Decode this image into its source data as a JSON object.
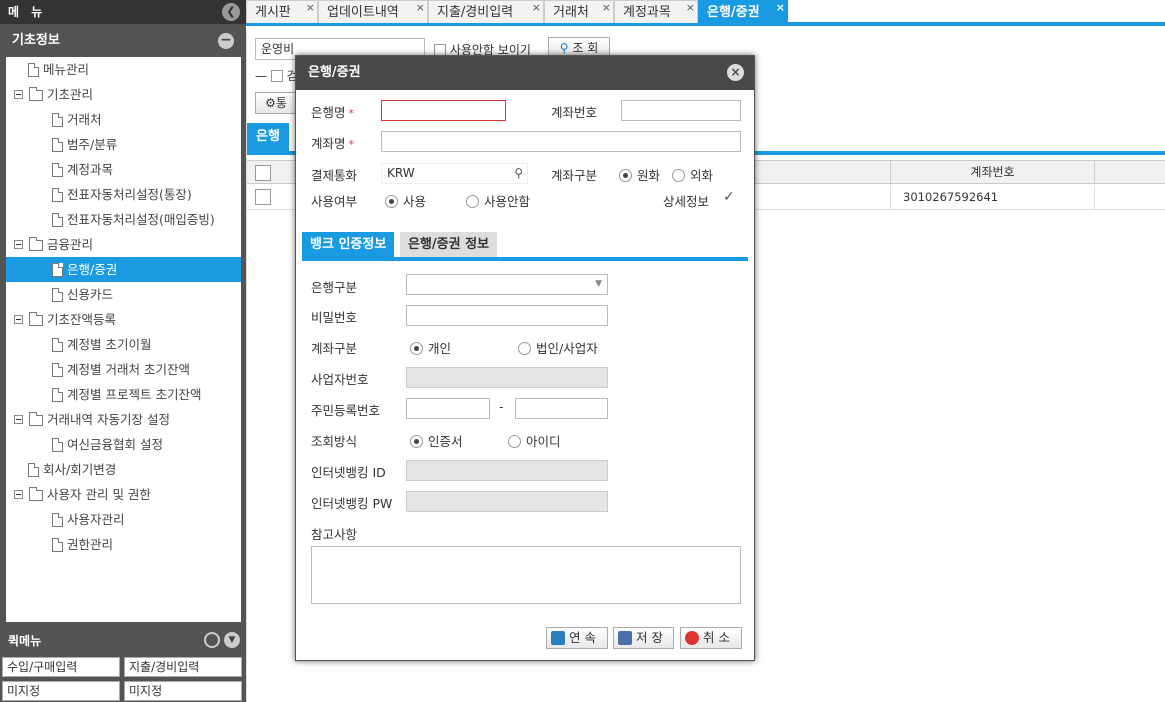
{
  "sidebar": {
    "header": "메 뉴",
    "section": "기초정보",
    "tree": [
      {
        "label": "메뉴관리",
        "kind": "doc",
        "level": 1
      },
      {
        "label": "기초관리",
        "kind": "folder",
        "level": 0
      },
      {
        "label": "거래처",
        "kind": "doc",
        "level": 2
      },
      {
        "label": "범주/분류",
        "kind": "doc",
        "level": 2
      },
      {
        "label": "계정과목",
        "kind": "doc",
        "level": 2
      },
      {
        "label": "전표자동처리설정(통장)",
        "kind": "doc",
        "level": 2
      },
      {
        "label": "전표자동처리설정(매입증빙)",
        "kind": "doc",
        "level": 2
      },
      {
        "label": "금융관리",
        "kind": "folder",
        "level": 0
      },
      {
        "label": "은행/증권",
        "kind": "doc",
        "level": 2,
        "selected": true
      },
      {
        "label": "신용카드",
        "kind": "doc",
        "level": 2
      },
      {
        "label": "기초잔액등록",
        "kind": "folder",
        "level": 0
      },
      {
        "label": "계정별 초기이월",
        "kind": "doc",
        "level": 2
      },
      {
        "label": "계정별 거래처 초기잔액",
        "kind": "doc",
        "level": 2
      },
      {
        "label": "계정별 프로젝트 초기잔액",
        "kind": "doc",
        "level": 2
      },
      {
        "label": "거래내역 자동기장 설정",
        "kind": "folder",
        "level": 0
      },
      {
        "label": "여신금융협회 설정",
        "kind": "doc",
        "level": 2
      },
      {
        "label": "회사/회기변경",
        "kind": "doc",
        "level": 1
      },
      {
        "label": "사용자 관리 및 권한",
        "kind": "folder",
        "level": 0
      },
      {
        "label": "사용자관리",
        "kind": "doc",
        "level": 2
      },
      {
        "label": "권한관리",
        "kind": "doc",
        "level": 2
      }
    ],
    "quick_title": "퀵메뉴",
    "quick_buttons": [
      "수입/구매입력",
      "지출/경비입력",
      "미지정",
      "미지정"
    ]
  },
  "tabs": [
    {
      "label": "게시판"
    },
    {
      "label": "업데이트내역"
    },
    {
      "label": "지출/경비입력"
    },
    {
      "label": "거래처"
    },
    {
      "label": "계정과목"
    },
    {
      "label": "은행/증권",
      "active": true
    }
  ],
  "main": {
    "search_value": "운영비",
    "show_unused_label": "사용안함 보이기",
    "search_button": "조 회",
    "check_label": "검",
    "toolbar_button": "통",
    "subtab": "은행",
    "grid_header": "계좌번호",
    "grid_row_account": "3010267592641"
  },
  "dialog": {
    "title": "은행/증권",
    "bank_name_label": "은행명",
    "account_no_label": "계좌번호",
    "account_name_label": "계좌명",
    "currency_label": "결제통화",
    "currency_value": "KRW",
    "account_type_label": "계좌구분",
    "account_type_options": [
      "원화",
      "외화"
    ],
    "use_label": "사용여부",
    "use_options": [
      "사용",
      "사용안함"
    ],
    "detail_label": "상세정보",
    "tab_auth": "뱅크 인증정보",
    "tab_info": "은행/증권 정보",
    "bank_type_label": "은행구분",
    "password_label": "비밀번호",
    "acct_kind_label": "계좌구분",
    "acct_kind_options": [
      "개인",
      "법인/사업자"
    ],
    "biz_no_label": "사업자번호",
    "resident_no_label": "주민등록번호",
    "resident_sep": "-",
    "query_method_label": "조회방식",
    "query_method_options": [
      "인증서",
      "아이디"
    ],
    "ib_id_label": "인터넷뱅킹 ID",
    "ib_pw_label": "인터넷뱅킹 PW",
    "memo_label": "참고사항",
    "btn_continue": "연 속",
    "btn_save": "저 장",
    "btn_cancel": "취 소",
    "required_mark": "*"
  },
  "colors": {
    "accent": "#1a9ae0",
    "sidebar": "#545454",
    "dialog_header": "#484848"
  }
}
